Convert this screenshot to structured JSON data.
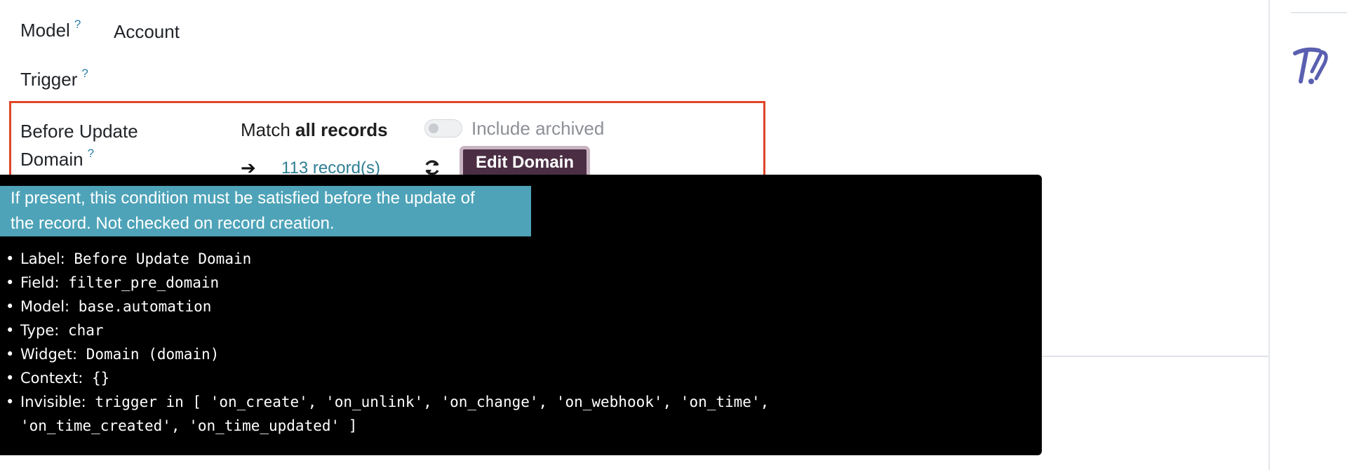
{
  "form": {
    "model_label": "Model",
    "help_mark": "?",
    "model_value": "Account",
    "trigger_label": "Trigger",
    "domain_label_line1": "Before Update",
    "domain_label_line2": "Domain",
    "match_prefix": "Match",
    "match_bold": "all records",
    "include_archived": "Include archived",
    "include_archived_on": false,
    "arrow": "➔",
    "records_link": "113 record(s)",
    "edit_domain": "Edit Domain"
  },
  "tooltip": {
    "help_line1": "If present, this condition must be satisfied before the update of",
    "help_line2": "the record. Not checked on record creation.",
    "items": [
      {
        "key": "Label:",
        "value": "Before Update Domain"
      },
      {
        "key": "Field:",
        "value": "filter_pre_domain"
      },
      {
        "key": "Model:",
        "value": "base.automation"
      },
      {
        "key": "Type:",
        "value": "char"
      },
      {
        "key": "Widget:",
        "value": "Domain (domain)"
      },
      {
        "key": "Context:",
        "value": "{}"
      },
      {
        "key": "Invisible:",
        "value": "trigger in [ 'on_create', 'on_unlink', 'on_change', 'on_webhook', 'on_time',"
      }
    ],
    "invisible_cont": "'on_time_created', 'on_time_updated' ]"
  },
  "colors": {
    "highlight": "#e0452a",
    "help_bg": "#4ea3b8",
    "button_bg": "#4b2e44",
    "link": "#2f7f93"
  }
}
